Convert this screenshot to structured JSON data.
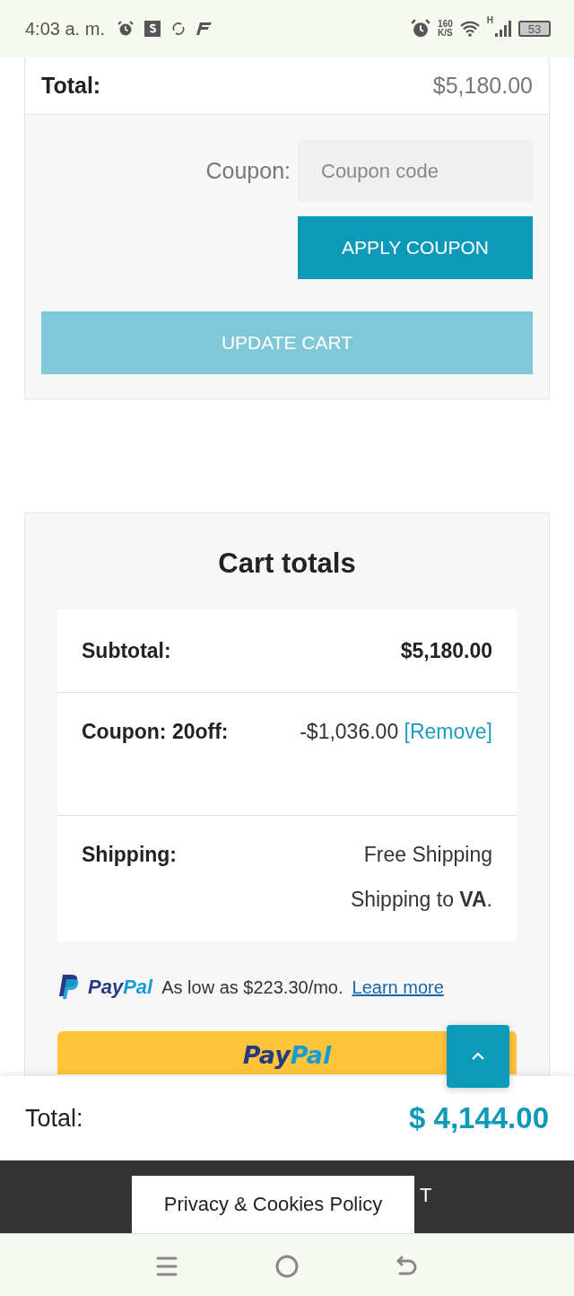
{
  "status_bar": {
    "time": "4:03 a. m.",
    "network_speed": "160",
    "network_speed_unit": "K/S",
    "network_type": "H",
    "battery": "53"
  },
  "cart": {
    "total_label": "Total:",
    "total_value": "$5,180.00",
    "coupon_label": "Coupon:",
    "coupon_placeholder": "Coupon code",
    "apply_button": "APPLY COUPON",
    "update_button": "UPDATE CART",
    "update_disabled": true
  },
  "cart_totals": {
    "title": "Cart totals",
    "rows": [
      {
        "kind": "amount",
        "label": "Subtotal:",
        "value": "$5,180.00"
      },
      {
        "kind": "coupon",
        "label": "Coupon: 20off:",
        "value": "-$1,036.00",
        "link": "[Remove]"
      },
      {
        "kind": "shipping",
        "label": "Shipping:",
        "value": "Free Shipping",
        "note": "Shipping to **VA**."
      }
    ],
    "paypal_message": {
      "brand": [
        "Pay",
        "Pal"
      ],
      "text": "As low as $223.30/mo.",
      "link": "Learn more"
    },
    "paypal_button": {
      "brand": [
        "Pay",
        "Pal"
      ]
    }
  },
  "sticky_total": {
    "label": "Total:",
    "value": "$ 4,144.00"
  },
  "footer": {
    "text": "T",
    "cookie_popup": "Privacy & Cookies Policy"
  }
}
